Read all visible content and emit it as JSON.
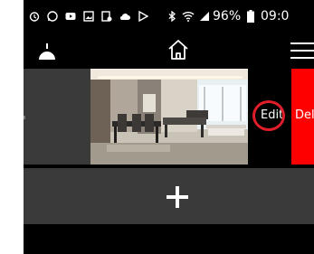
{
  "status_bar": {
    "battery_percent": "96%",
    "time": "09:0",
    "icons": [
      "alarm-icon",
      "whatsapp-icon",
      "youtube-icon",
      "gallery-icon",
      "download-icon",
      "cloud-icon",
      "play-store-icon",
      "bluetooth-icon",
      "wifi-icon",
      "signal-icon",
      "battery-icon"
    ]
  },
  "app_bar": {
    "icons": [
      "lamp-icon",
      "home-icon",
      "hamburger-menu-icon"
    ]
  },
  "list_row": {
    "edit_label": "Edit",
    "delete_label": "Del",
    "colors": {
      "delete": "#ff0000",
      "highlight_ring": "#e01e2a"
    }
  },
  "add_row": {
    "icon": "plus-icon"
  }
}
